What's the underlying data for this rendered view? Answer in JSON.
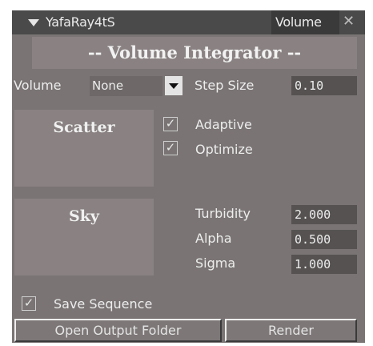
{
  "titlebar": {
    "title": "YafaRay4tS",
    "tab_label": "Volume",
    "close_glyph": "✕",
    "menu_icon": "triangle-down-icon"
  },
  "heading": "-- Volume Integrator --",
  "volume_row": {
    "label": "Volume",
    "selected": "None",
    "step_size_label": "Step Size",
    "step_size_value": "0.10"
  },
  "scatter": {
    "button_label": "Scatter",
    "adaptive_label": "Adaptive",
    "adaptive_checked": true,
    "optimize_label": "Optimize",
    "optimize_checked": true
  },
  "sky": {
    "button_label": "Sky",
    "params": [
      {
        "label": "Turbidity",
        "value": "2.000"
      },
      {
        "label": "Alpha",
        "value": "0.500"
      },
      {
        "label": "Sigma",
        "value": "1.000"
      }
    ]
  },
  "save_sequence": {
    "label": "Save Sequence",
    "checked": true
  },
  "buttons": {
    "open_output": "Open Output Folder",
    "render": "Render"
  },
  "colors": {
    "panel_bg": "#7a7474",
    "titlebar_bg": "#4a4a4a",
    "field_bg": "#565252"
  }
}
